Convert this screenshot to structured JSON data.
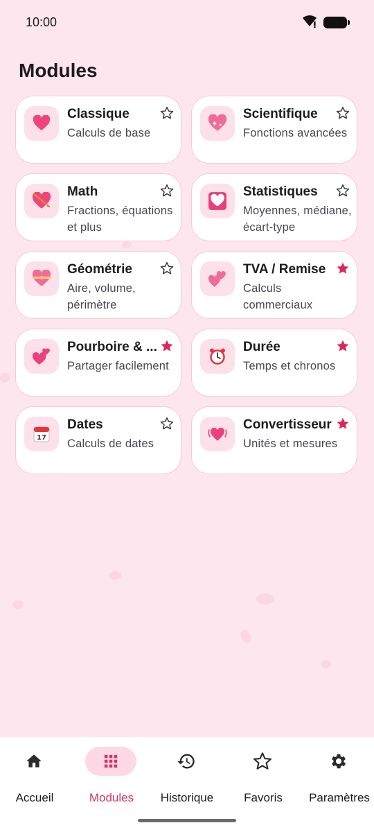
{
  "status": {
    "time": "10:00"
  },
  "page": {
    "title": "Modules"
  },
  "modules": [
    {
      "title": "Classique",
      "subtitle": "Calculs de base",
      "icon": "heart-icon",
      "favorite": false
    },
    {
      "title": "Scientifique",
      "subtitle": "Fonctions avancées",
      "icon": "sparkling-heart-icon",
      "favorite": false
    },
    {
      "title": "Math",
      "subtitle": "Fractions, équations et plus",
      "icon": "heart-with-arrow-icon",
      "favorite": false
    },
    {
      "title": "Statistiques",
      "subtitle": "Moyennes, médiane, écart-type",
      "icon": "heart-decoration-icon",
      "favorite": false
    },
    {
      "title": "Géométrie",
      "subtitle": "Aire, volume, périmètre",
      "icon": "heart-with-ribbon-icon",
      "favorite": false
    },
    {
      "title": "TVA / Remise",
      "subtitle": "Calculs commerciaux",
      "icon": "two-hearts-icon",
      "favorite": true
    },
    {
      "title": "Pourboire & ...",
      "subtitle": "Partager facilement",
      "icon": "revolving-hearts-icon",
      "favorite": true
    },
    {
      "title": "Durée",
      "subtitle": "Temps et chronos",
      "icon": "alarm-clock-icon",
      "favorite": true
    },
    {
      "title": "Dates",
      "subtitle": "Calculs de dates",
      "icon": "calendar-icon",
      "favorite": false
    },
    {
      "title": "Convertisseur",
      "subtitle": "Unités et mesures",
      "icon": "beating-heart-icon",
      "favorite": true
    }
  ],
  "nav": [
    {
      "label": "Accueil",
      "icon": "home-icon",
      "active": false
    },
    {
      "label": "Modules",
      "icon": "grid-icon",
      "active": true
    },
    {
      "label": "Historique",
      "icon": "history-icon",
      "active": false
    },
    {
      "label": "Favoris",
      "icon": "star-icon",
      "active": false
    },
    {
      "label": "Paramètres",
      "icon": "gear-icon",
      "active": false
    }
  ],
  "colors": {
    "background": "#fde6ee",
    "accent": "#d6336c",
    "favorite_star": "#e0245e"
  }
}
